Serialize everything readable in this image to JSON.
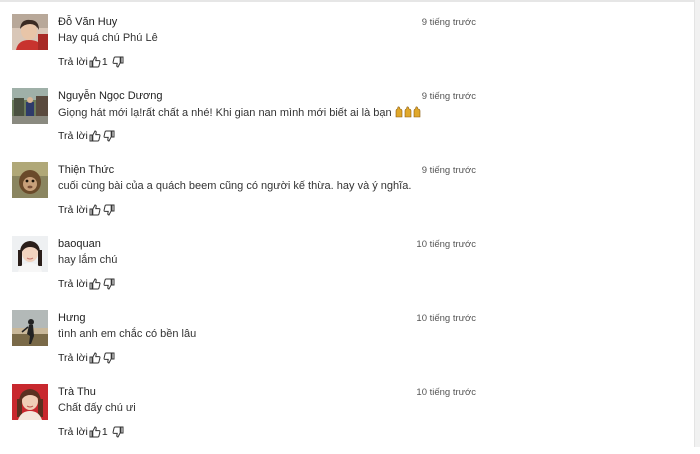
{
  "comments": [
    {
      "author": "Đỗ Văn Huy",
      "time": "9 tiếng trước",
      "text": "Hay quá chú Phú Lê",
      "reply_label": "Trả lời",
      "likes": "1",
      "avatar": "avatar-girl-red-shirt",
      "emoji_count": 0
    },
    {
      "author": "Nguyễn Ngọc Dương",
      "time": "9 tiếng trước",
      "text": "Giọng hát mới lạ!rất chất a nhé! Khi gian nan mình mới biết ai là bạn",
      "reply_label": "Trả lời",
      "likes": "",
      "avatar": "avatar-street-scene",
      "emoji_count": 3,
      "emoji": "raised-hands-emoji"
    },
    {
      "author": "Thiện Thức",
      "time": "9 tiếng trước",
      "text": "cuối cùng bài của a quách beem cũng có người kế thừa. hay và ý nghĩa.",
      "reply_label": "Trả lời",
      "likes": "",
      "avatar": "avatar-monkey",
      "emoji_count": 0
    },
    {
      "author": "baoquan",
      "time": "10 tiếng trước",
      "text": "hay lắm chú",
      "reply_label": "Trả lời",
      "likes": "",
      "avatar": "avatar-girl-portrait",
      "emoji_count": 0
    },
    {
      "author": "Hưng",
      "time": "10 tiếng trước",
      "text": "tình anh em chắc có bền lâu",
      "reply_label": "Trả lời",
      "likes": "",
      "avatar": "avatar-silhouette-field",
      "emoji_count": 0
    },
    {
      "author": "Trà Thu",
      "time": "10 tiếng trước",
      "text": "Chất đấy chú ưi",
      "reply_label": "Trả lời",
      "likes": "1",
      "avatar": "avatar-girl-red-background",
      "emoji_count": 0
    }
  ]
}
